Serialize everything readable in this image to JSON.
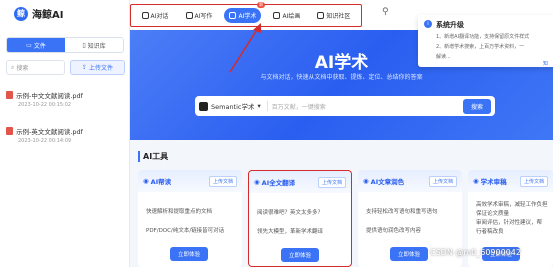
{
  "app": {
    "logo_text": "海鲸AI",
    "logo_mark": "鲸"
  },
  "sidebar": {
    "tabs": [
      {
        "label": "文件"
      },
      {
        "label": "知识库"
      }
    ],
    "search_placeholder": "搜索",
    "upload_label": "上传文件",
    "files": [
      {
        "name": "示例-中文文献阅读.pdf",
        "date": "2023-10-22 00:15:02"
      },
      {
        "name": "示例-英文文献阅读.pdf",
        "date": "2023-10-22 00:14:09"
      }
    ]
  },
  "nav": {
    "items": [
      {
        "label": "AI对话"
      },
      {
        "label": "AI写作"
      },
      {
        "label": "AI学术",
        "badge": "新"
      },
      {
        "label": "AI绘画"
      },
      {
        "label": "知识社区"
      }
    ]
  },
  "hero": {
    "title": "AI学术",
    "subtitle": "与文档对话，快速从文档中获取、提炼、定位、总结你的答案",
    "engine": "Semantic学术",
    "placeholder": "百万文献，一键搜索",
    "search_button": "搜索"
  },
  "tools": {
    "section_title": "AI工具",
    "cards": [
      {
        "title": "AI帮读",
        "tag": "上传文档",
        "bullets": [
          "快速解析和提取重点的文档",
          "PDF/DOC/纯文本/链接皆可对话"
        ],
        "button": "立即体验"
      },
      {
        "title": "AI全文翻译",
        "tag": "上传文档",
        "bullets": [
          "阅读很难吧？英文太多多？",
          "领先大模型，革新学术翻译"
        ],
        "button": "立即体验"
      },
      {
        "title": "AI文章润色",
        "tag": "上传文档",
        "bullets": [
          "支持轻松改写语句和重写语句",
          "提供语句润色改写内容"
        ],
        "button": "立即体验"
      },
      {
        "title": "学术审稿",
        "tag": "上传文档",
        "bullets": [
          "高效学术审稿，减轻工作负担",
          "保证论文质量",
          "审阅评估，针对性建议，帮",
          "行者稿改良"
        ],
        "button": "立即体验"
      }
    ]
  },
  "notice": {
    "title": "系统升级",
    "lines": [
      "1、新增AI翻译功能，支持保留原文件样式",
      "2、新增学术搜索，上百万学术资料，一",
      "解读..."
    ],
    "link": "知"
  },
  "watermark": "CSDN @m0_60900042"
}
